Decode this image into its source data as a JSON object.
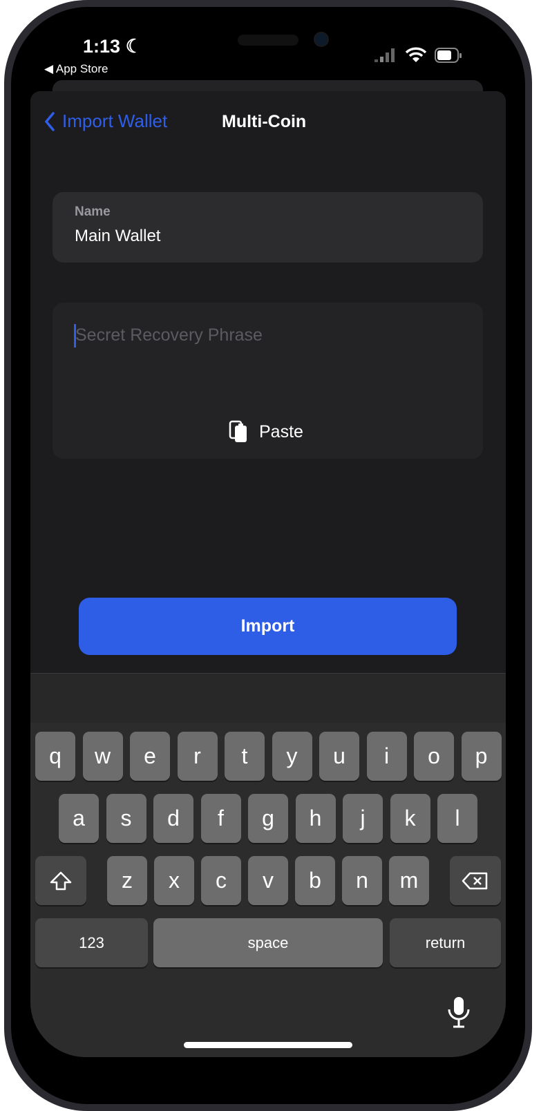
{
  "status_bar": {
    "time": "1:13",
    "back_app": "◀ App Store"
  },
  "nav": {
    "back_label": "Import Wallet",
    "title": "Multi-Coin"
  },
  "name_field": {
    "label": "Name",
    "value": "Main Wallet"
  },
  "phrase_field": {
    "placeholder": "Secret Recovery Phrase",
    "value": ""
  },
  "paste_label": "Paste",
  "import_label": "Import",
  "colors": {
    "accent": "#2e5de6",
    "background": "#1c1c1e"
  },
  "keyboard": {
    "row1": [
      "q",
      "w",
      "e",
      "r",
      "t",
      "y",
      "u",
      "i",
      "o",
      "p"
    ],
    "row2": [
      "a",
      "s",
      "d",
      "f",
      "g",
      "h",
      "j",
      "k",
      "l"
    ],
    "row3": [
      "z",
      "x",
      "c",
      "v",
      "b",
      "n",
      "m"
    ],
    "numbers": "123",
    "space": "space",
    "return": "return"
  }
}
